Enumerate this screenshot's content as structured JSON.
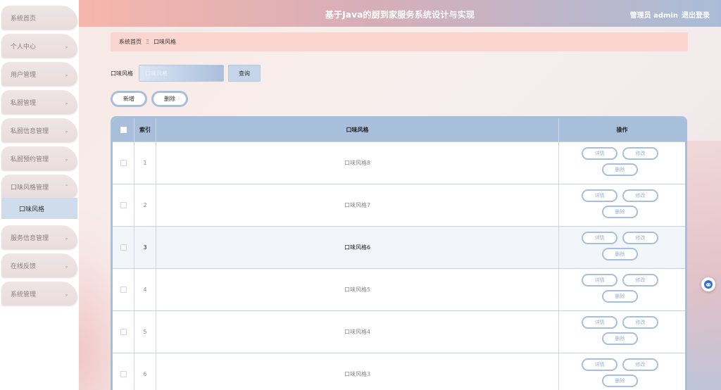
{
  "header": {
    "title": "基于Java的厨到家服务系统设计与实现",
    "user": "管理员 admin",
    "logout": "退出登录"
  },
  "sidebar": {
    "items": [
      {
        "label": "系统首页",
        "chevron": false
      },
      {
        "label": "个人中心",
        "chevron": true
      },
      {
        "label": "用户管理",
        "chevron": true
      },
      {
        "label": "私厨管理",
        "chevron": true
      },
      {
        "label": "私厨信息管理",
        "chevron": true
      },
      {
        "label": "私厨预约管理",
        "chevron": true
      },
      {
        "label": "口味风格管理",
        "chevron": true,
        "expanded": true
      },
      {
        "label": "服务信息管理",
        "chevron": true
      },
      {
        "label": "在线反馈",
        "chevron": true
      },
      {
        "label": "系统管理",
        "chevron": true
      }
    ],
    "submenu": {
      "label": "口味风格"
    }
  },
  "breadcrumb": {
    "home": "系统首页",
    "separator": "Ξ",
    "current": "口味风格"
  },
  "search": {
    "label": "口味风格",
    "placeholder": "口味风格",
    "button": "查询"
  },
  "actions": {
    "add": "新增",
    "delete": "删除"
  },
  "table": {
    "headers": {
      "index": "索引",
      "name": "口味风格",
      "ops": "操作"
    },
    "op_labels": {
      "detail": "详情",
      "edit": "修改",
      "delete": "删除"
    },
    "rows": [
      {
        "index": "1",
        "name": "口味风格8"
      },
      {
        "index": "2",
        "name": "口味风格7"
      },
      {
        "index": "3",
        "name": "口味风格6",
        "highlighted": true
      },
      {
        "index": "4",
        "name": "口味风格5"
      },
      {
        "index": "5",
        "name": "口味风格4"
      },
      {
        "index": "6",
        "name": "口味风格3"
      }
    ]
  },
  "colors": {
    "accent": "#a8bfdc",
    "header_start": "#f6b6ac",
    "header_end": "#a9bcd7",
    "breadcrumb_bg": "#fbd6d1"
  },
  "float_icon": "assistant-icon"
}
